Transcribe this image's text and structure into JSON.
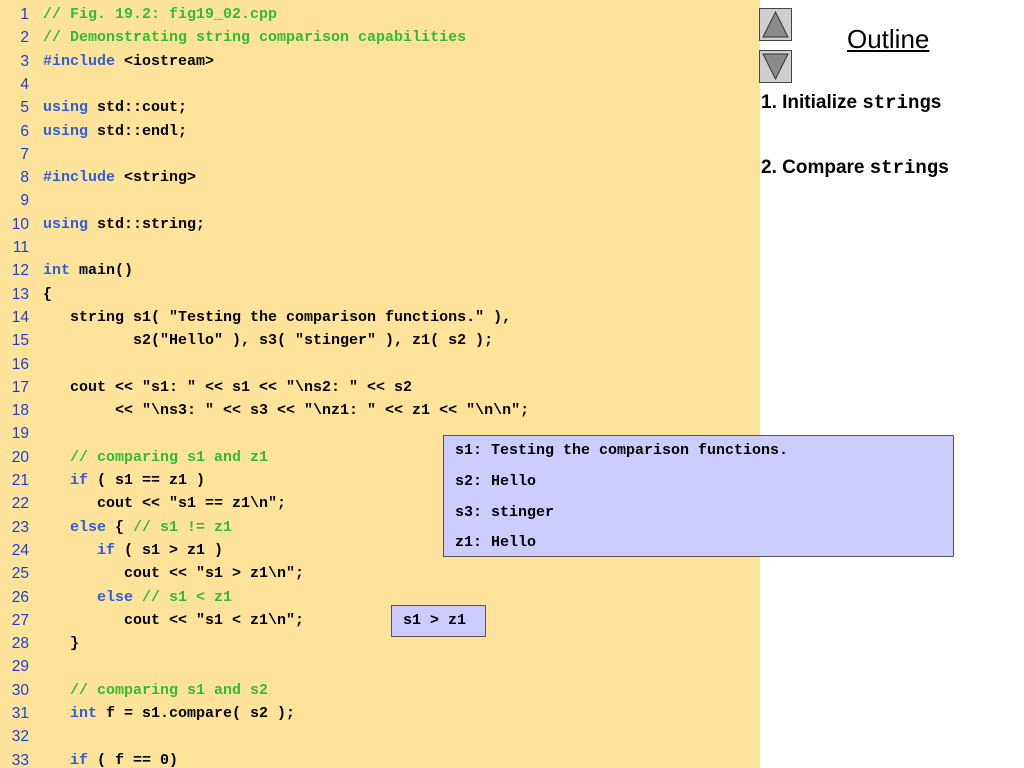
{
  "code": {
    "lines": [
      {
        "n": "1",
        "parts": [
          {
            "t": "// Fig. 19.2: fig19_02.cpp",
            "k": "cm"
          }
        ]
      },
      {
        "n": "2",
        "parts": [
          {
            "t": "// Demonstrating string comparison capabilities",
            "k": "cm"
          }
        ]
      },
      {
        "n": "3",
        "parts": [
          {
            "t": "#include",
            "k": "kw"
          },
          {
            "t": " <iostream>",
            "k": ""
          }
        ]
      },
      {
        "n": "4",
        "parts": []
      },
      {
        "n": "5",
        "parts": [
          {
            "t": "using",
            "k": "kw"
          },
          {
            "t": " std::cout;",
            "k": ""
          }
        ]
      },
      {
        "n": "6",
        "parts": [
          {
            "t": "using",
            "k": "kw"
          },
          {
            "t": " std::endl;",
            "k": ""
          }
        ]
      },
      {
        "n": "7",
        "parts": []
      },
      {
        "n": "8",
        "parts": [
          {
            "t": "#include",
            "k": "kw"
          },
          {
            "t": " <string>",
            "k": ""
          }
        ]
      },
      {
        "n": "9",
        "parts": []
      },
      {
        "n": "10",
        "parts": [
          {
            "t": "using",
            "k": "kw"
          },
          {
            "t": " std::string;",
            "k": ""
          }
        ]
      },
      {
        "n": "11",
        "parts": []
      },
      {
        "n": "12",
        "parts": [
          {
            "t": "int",
            "k": "kw"
          },
          {
            "t": " main()",
            "k": ""
          }
        ]
      },
      {
        "n": "13",
        "parts": [
          {
            "t": "{",
            "k": ""
          }
        ]
      },
      {
        "n": "14",
        "parts": [
          {
            "t": "   string s1( \"Testing the comparison functions.\" ),",
            "k": ""
          }
        ]
      },
      {
        "n": "15",
        "parts": [
          {
            "t": "          s2(\"Hello\" ), s3( \"stinger\" ), z1( s2 );",
            "k": ""
          }
        ]
      },
      {
        "n": "16",
        "parts": []
      },
      {
        "n": "17",
        "parts": [
          {
            "t": "   cout << \"s1: \" << s1 << \"\\ns2: \" << s2",
            "k": ""
          }
        ]
      },
      {
        "n": "18",
        "parts": [
          {
            "t": "        << \"\\ns3: \" << s3 << \"\\nz1: \" << z1 << \"\\n\\n\";",
            "k": ""
          }
        ]
      },
      {
        "n": "19",
        "parts": []
      },
      {
        "n": "20",
        "parts": [
          {
            "t": "   ",
            "k": ""
          },
          {
            "t": "// comparing s1 and z1",
            "k": "cm"
          }
        ]
      },
      {
        "n": "21",
        "parts": [
          {
            "t": "   ",
            "k": ""
          },
          {
            "t": "if",
            "k": "kw"
          },
          {
            "t": " ( s1 == z1 )",
            "k": ""
          }
        ]
      },
      {
        "n": "22",
        "parts": [
          {
            "t": "      cout << \"s1 == z1\\n\";",
            "k": ""
          }
        ]
      },
      {
        "n": "23",
        "parts": [
          {
            "t": "   ",
            "k": ""
          },
          {
            "t": "else",
            "k": "kw"
          },
          {
            "t": " { ",
            "k": ""
          },
          {
            "t": "// s1 != z1",
            "k": "cm"
          }
        ]
      },
      {
        "n": "24",
        "parts": [
          {
            "t": "      ",
            "k": ""
          },
          {
            "t": "if",
            "k": "kw"
          },
          {
            "t": " ( s1 > z1 )",
            "k": ""
          }
        ]
      },
      {
        "n": "25",
        "parts": [
          {
            "t": "         cout << \"s1 > z1\\n\";",
            "k": ""
          }
        ]
      },
      {
        "n": "26",
        "parts": [
          {
            "t": "      ",
            "k": ""
          },
          {
            "t": "else",
            "k": "kw"
          },
          {
            "t": " ",
            "k": ""
          },
          {
            "t": "// s1 < z1",
            "k": "cm"
          }
        ]
      },
      {
        "n": "27",
        "parts": [
          {
            "t": "         cout << \"s1 < z1\\n\";",
            "k": ""
          }
        ]
      },
      {
        "n": "28",
        "parts": [
          {
            "t": "   }",
            "k": ""
          }
        ]
      },
      {
        "n": "29",
        "parts": []
      },
      {
        "n": "30",
        "parts": [
          {
            "t": "   ",
            "k": ""
          },
          {
            "t": "// comparing s1 and s2",
            "k": "cm"
          }
        ]
      },
      {
        "n": "31",
        "parts": [
          {
            "t": "   ",
            "k": ""
          },
          {
            "t": "int",
            "k": "kw"
          },
          {
            "t": " f = s1.compare( s2 );",
            "k": ""
          }
        ]
      },
      {
        "n": "32",
        "parts": []
      },
      {
        "n": "33",
        "parts": [
          {
            "t": "   ",
            "k": ""
          },
          {
            "t": "if",
            "k": "kw"
          },
          {
            "t": " ( f == 0)",
            "k": ""
          }
        ]
      }
    ]
  },
  "nav": {
    "up_icon": "triangle-up-icon",
    "down_icon": "triangle-down-icon"
  },
  "outline": {
    "title": "Outline",
    "items": [
      {
        "prefix": "1. Initialize ",
        "code": "string",
        "suffix": "s"
      },
      {
        "prefix": "2. Compare ",
        "code": "string",
        "suffix": "s"
      }
    ]
  },
  "output": {
    "lines": [
      "s1: Testing the comparison functions.",
      "s2: Hello",
      "s3: stinger",
      "z1: Hello"
    ],
    "result": "s1 > z1"
  },
  "colors": {
    "code_background": "#ffe39b",
    "output_background": "#ccccff",
    "keyword": "#2f5fd6",
    "comment": "#33bb33",
    "line_number": "#1f3fcf"
  }
}
